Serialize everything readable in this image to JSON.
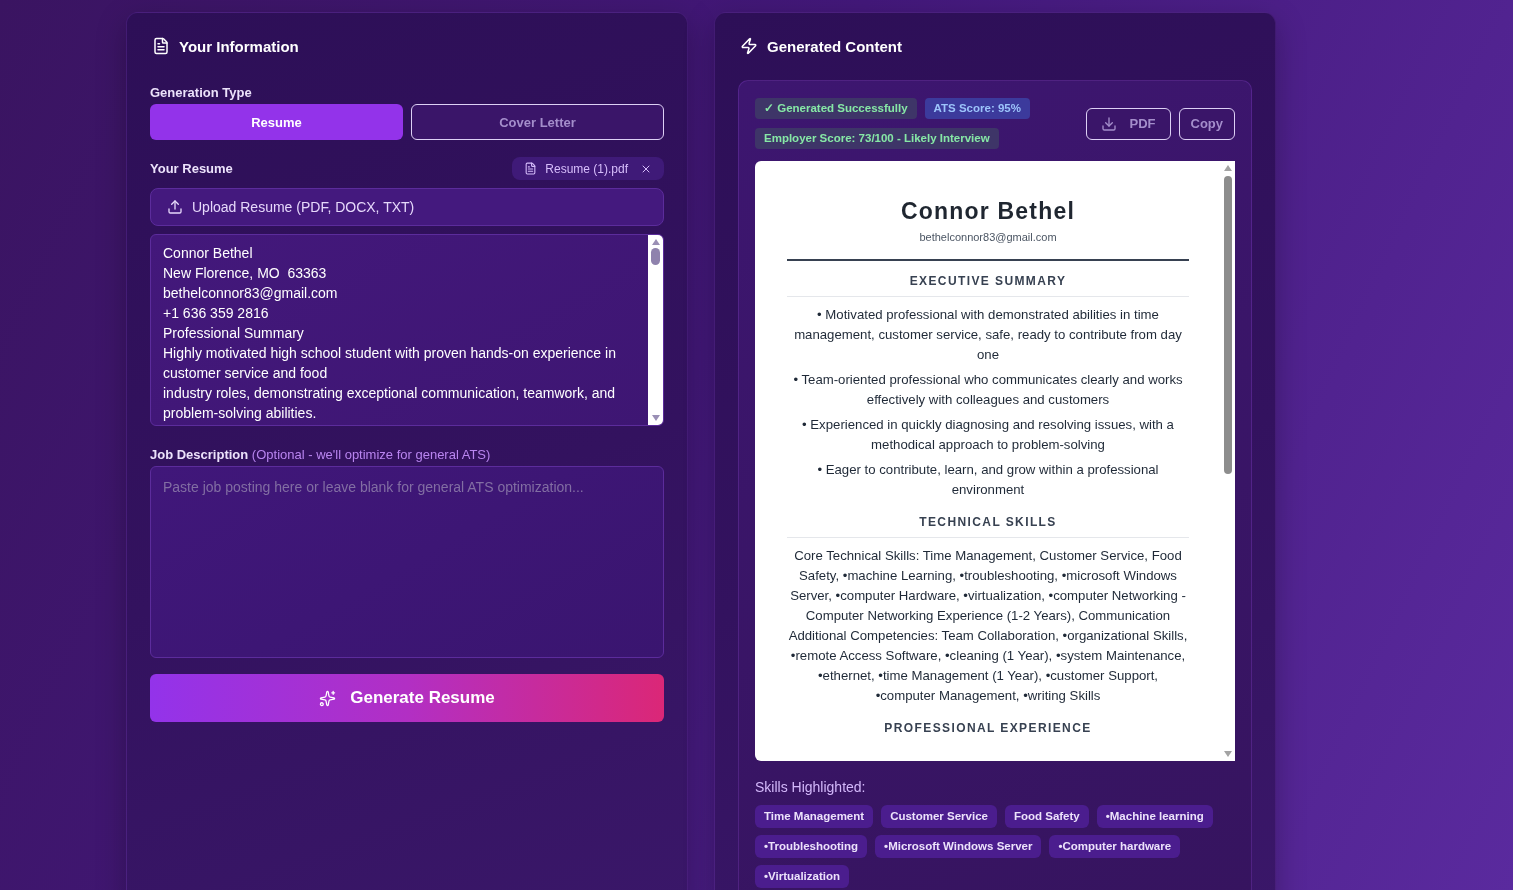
{
  "information_panel": {
    "title": "Your Information",
    "generation_type": {
      "label": "Generation Type",
      "options": [
        {
          "label": "Resume",
          "selected": true
        },
        {
          "label": "Cover Letter",
          "selected": false
        }
      ]
    },
    "resume": {
      "label": "Your Resume",
      "attached_file": "Resume (1).pdf",
      "upload_button": "Upload Resume (PDF, DOCX, TXT)",
      "text": "Connor Bethel\nNew Florence, MO  63363\nbethelconnor83@gmail.com\n+1 636 359 2816\nProfessional Summary\nHighly motivated high school student with proven hands-on experience in customer service and food\nindustry roles, demonstrating exceptional communication, teamwork, and problem-solving abilities."
    },
    "job_description": {
      "label": "**Job Description** (Optional - we'll optimize for general ATS)",
      "placeholder": "Paste job posting here or leave blank for general ATS optimization..."
    },
    "generate_button": "Generate Resume"
  },
  "generated_panel": {
    "title": "Generated Content",
    "badges": [
      {
        "text": "✓ Generated Successfully",
        "kind": "success"
      },
      {
        "text": "ATS Score: 95%",
        "kind": "info"
      },
      {
        "text": "Employer Score: 73/100 - Likely Interview",
        "kind": "success"
      }
    ],
    "actions": [
      {
        "label": "PDF",
        "kind": "download"
      },
      {
        "label": "Copy",
        "kind": "copy"
      }
    ],
    "document": {
      "name": "Connor Bethel",
      "email": "bethelconnor83@gmail.com",
      "sections": [
        {
          "heading": "EXECUTIVE SUMMARY",
          "kind": "bullets",
          "items": [
            "• Motivated professional with demonstrated abilities in time management, customer service, safe, ready to contribute from day one",
            "• Team-oriented professional who communicates clearly and works effectively with colleagues and customers",
            "• Experienced in quickly diagnosing and resolving issues, with a methodical approach to problem-solving",
            "• Eager to contribute, learn, and grow within a professional environment"
          ]
        },
        {
          "heading": "TECHNICAL SKILLS",
          "kind": "paragraphs",
          "items": [
            "Core Technical Skills: Time Management, Customer Service, Food Safety, •machine Learning, •troubleshooting, •microsoft Windows Server, •computer Hardware, •virtualization, •computer Networking - Computer Networking Experience (1-2 Years), Communication",
            "Additional Competencies: Team Collaboration, •organizational Skills, •remote Access Software, •cleaning (1 Year), •system Maintenance, •ethernet, •time Management (1 Year), •customer Support, •computer Management, •writing Skills"
          ]
        },
        {
          "heading": "PROFESSIONAL EXPERIENCE"
        }
      ]
    },
    "skills_label": "Skills Highlighted:",
    "skills": [
      "Time Management",
      "Customer Service",
      "Food Safety",
      "•Machine learning",
      "•Troubleshooting",
      "•Microsoft Windows Server",
      "•Computer hardware",
      "•Virtualization"
    ]
  }
}
